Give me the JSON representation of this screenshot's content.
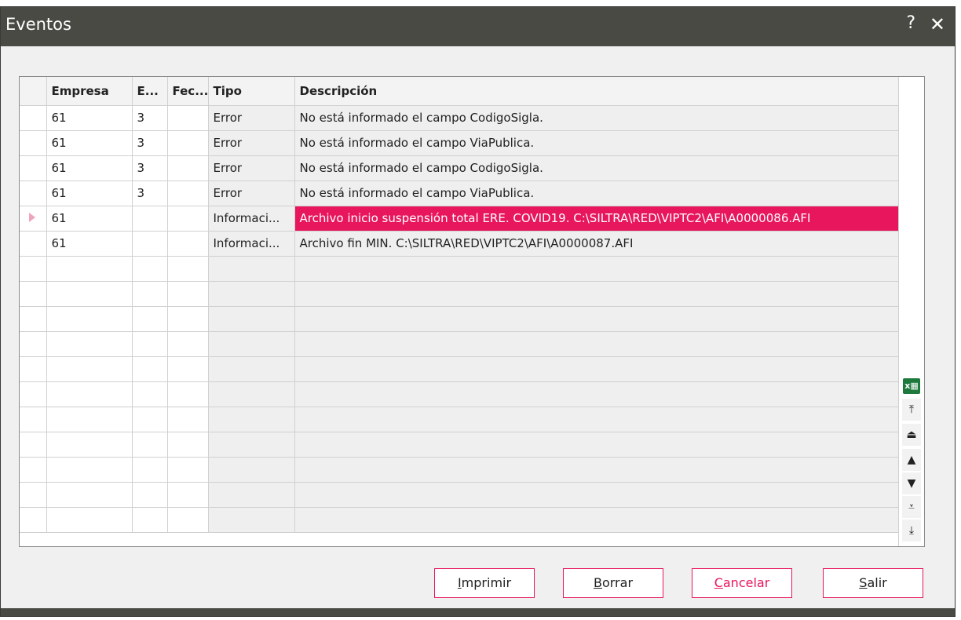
{
  "window": {
    "title": "Eventos",
    "help": "?",
    "close": "✕"
  },
  "table": {
    "headers": [
      "Empresa",
      "E...",
      "Fec...",
      "Tipo",
      "Descripción"
    ],
    "rows": [
      {
        "empresa": "61",
        "e": "3",
        "fec": "",
        "tipo": "Error",
        "desc": "No está informado el campo CodigoSigla."
      },
      {
        "empresa": "61",
        "e": "3",
        "fec": "",
        "tipo": "Error",
        "desc": "No está informado el campo ViaPublica."
      },
      {
        "empresa": "61",
        "e": "3",
        "fec": "",
        "tipo": "Error",
        "desc": "No está informado el campo CodigoSigla."
      },
      {
        "empresa": "61",
        "e": "3",
        "fec": "",
        "tipo": "Error",
        "desc": "No está informado el campo ViaPublica."
      },
      {
        "empresa": "61",
        "e": "",
        "fec": "",
        "tipo": "Informaci...",
        "desc": "Archivo inicio suspensión total ERE. COVID19. C:\\SILTRA\\RED\\VIPTC2\\AFI\\A0000086.AFI"
      },
      {
        "empresa": "61",
        "e": "",
        "fec": "",
        "tipo": "Informaci...",
        "desc": "Archivo fin MIN. C:\\SILTRA\\RED\\VIPTC2\\AFI\\A0000087.AFI"
      }
    ],
    "selected_row": 4
  },
  "sidebar": {
    "excel_icon": "excel-export-icon",
    "nav": [
      {
        "icon": "first-icon",
        "glyph": "⤒"
      },
      {
        "icon": "page-up-icon",
        "glyph": "⏏"
      },
      {
        "icon": "prev-icon",
        "glyph": "▲"
      },
      {
        "icon": "next-icon",
        "glyph": "▼"
      },
      {
        "icon": "page-down-icon",
        "glyph": "⩡"
      },
      {
        "icon": "last-icon",
        "glyph": "⤓"
      }
    ]
  },
  "buttons": {
    "print": {
      "key": "I",
      "rest": "mprimir"
    },
    "delete": {
      "key": "B",
      "rest": "orrar"
    },
    "cancel": {
      "key": "C",
      "rest": "ancelar"
    },
    "exit": {
      "key": "S",
      "rest": "alir"
    }
  },
  "colors": {
    "accent": "#e8175d",
    "titlebar": "#4a4a45"
  }
}
